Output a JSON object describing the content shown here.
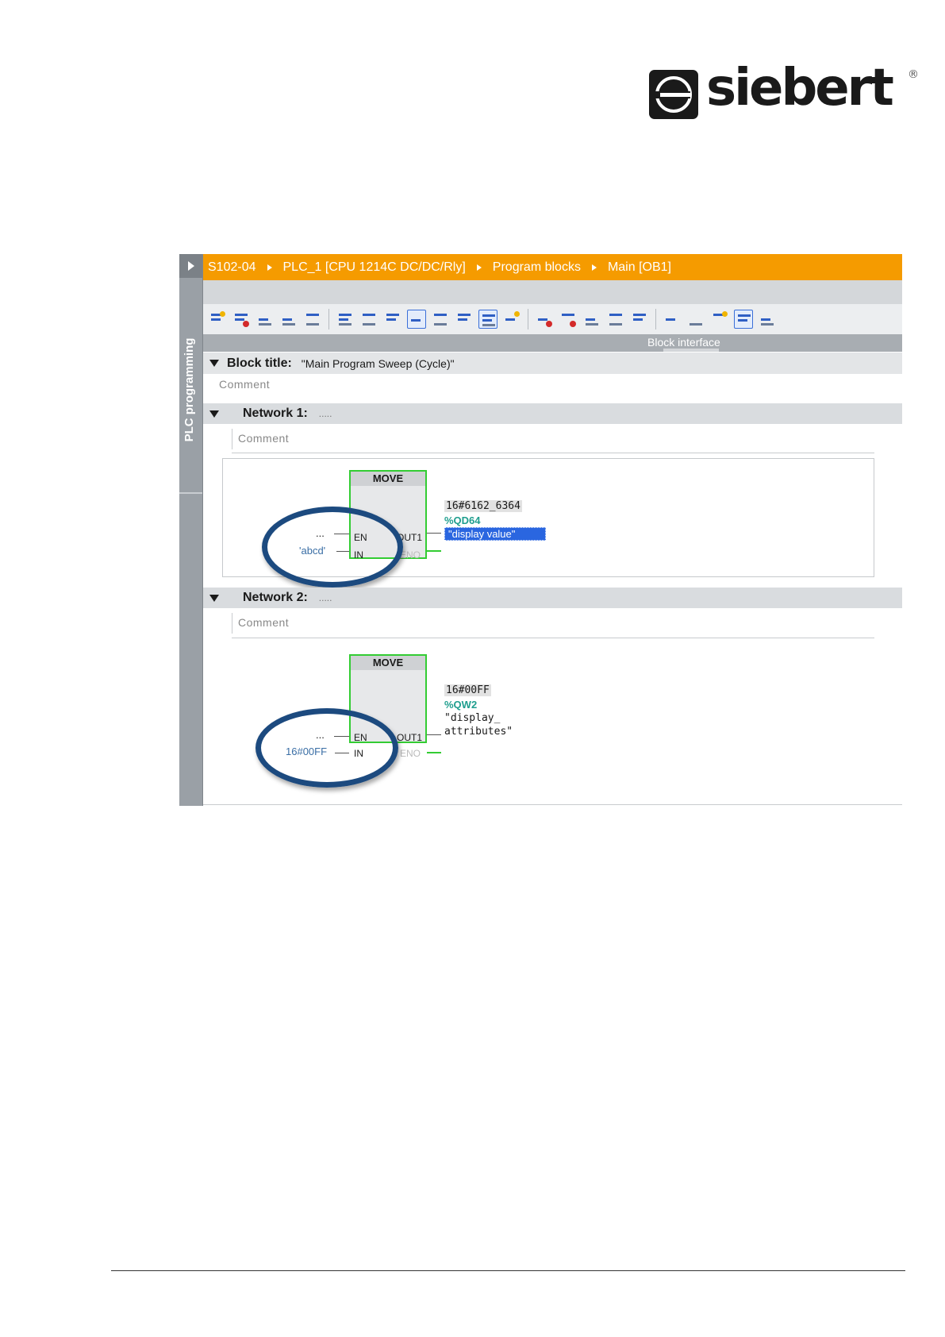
{
  "logo": {
    "text": "siebert",
    "registered": "®"
  },
  "sidebar": {
    "label": "PLC programming"
  },
  "breadcrumb": [
    "S102-04",
    "PLC_1 [CPU 1214C DC/DC/Rly]",
    "Program blocks",
    "Main [OB1]"
  ],
  "toolbar": {
    "interface_label": "Block interface"
  },
  "block": {
    "title_key": "Block title:",
    "title_value": "\"Main Program Sweep (Cycle)\"",
    "comment": "Comment"
  },
  "networks": [
    {
      "label": "Network 1:",
      "title": ".....",
      "comment": "Comment",
      "move": {
        "title": "MOVE",
        "pin_en": "EN",
        "pin_in": "IN",
        "pin_out": "OUT1",
        "pin_eno": "ENO",
        "en_input": "...",
        "in_input": "'abcd'",
        "out_const": "16#6162_6364",
        "out_addr": "%QD64",
        "out_tag": "\"display value\""
      }
    },
    {
      "label": "Network 2:",
      "title": ".....",
      "comment": "Comment",
      "move": {
        "title": "MOVE",
        "pin_en": "EN",
        "pin_in": "IN",
        "pin_out": "OUT1",
        "pin_eno": "ENO",
        "en_input": "...",
        "in_input": "16#00FF",
        "out_const": "16#00FF",
        "out_addr": "%QW2",
        "out_tag_line1": "\"display_",
        "out_tag_line2": "attributes\""
      }
    }
  ],
  "colors": {
    "breadcrumb": "#f59b00",
    "move_border": "#33cc33",
    "highlight_ellipse": "#1c4a7f",
    "selection": "#2a66e0"
  }
}
